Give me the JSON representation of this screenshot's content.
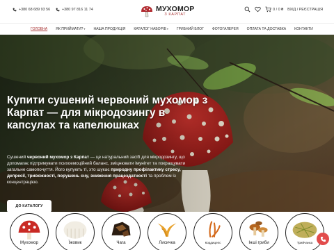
{
  "header": {
    "phones": [
      "+380 68 689 93 56",
      "+380 97 816 11 74"
    ],
    "logo": {
      "title": "МУХОМОР",
      "subtitle": "З КАРПАТ"
    },
    "cart": "0 / 0 ₴",
    "login": "ВХІД / РЕЄСТРАЦІЯ"
  },
  "nav": {
    "items": [
      {
        "label": "ГОЛОВНА",
        "active": true
      },
      {
        "label": "ЯК ПРИЙМАТИ?",
        "has_dropdown": true
      },
      {
        "label": "НАША ПРОДУКЦІЯ",
        "has_dropdown": false
      },
      {
        "label": "КАТАЛОГ НАБОРІВ",
        "has_dropdown": true
      },
      {
        "label": "ГРИБНИЙ БЛОГ",
        "has_dropdown": false
      },
      {
        "label": "ФОТОГАЛЕРЕЯ",
        "has_dropdown": false
      },
      {
        "label": "ОПЛАТА ТА ДОСТАВКА",
        "has_dropdown": false
      },
      {
        "label": "КОНТАКТИ",
        "has_dropdown": false
      }
    ]
  },
  "hero": {
    "title": "Купити сушений червоний мухомор з Карпат — для мікродозингу в капсулах та капелюшках",
    "text_parts": [
      {
        "t": "Сушений ",
        "bold": false
      },
      {
        "t": "червоний мухомор з Карпат",
        "bold": true
      },
      {
        "t": " — це натуральний засіб для мікродозингу, що допомагає підтримувати психоемоційний баланс, зміцнювати імунітет та покращувати загальне самопочуття. Його купують ті, хто шукає ",
        "bold": false
      },
      {
        "t": "природну профілактику стресу, депресії, тривожності, порушень сну, зниження працездатності",
        "bold": true
      },
      {
        "t": " та проблем із концентрацією.",
        "bold": false
      }
    ],
    "button": "ДО КАТАЛОГУ"
  },
  "categories": [
    {
      "label": "Мухомор",
      "icon": "fly-agaric-icon"
    },
    {
      "label": "Їжовик",
      "icon": "lions-mane-icon"
    },
    {
      "label": "Чага",
      "icon": "chaga-icon"
    },
    {
      "label": "Лисичка",
      "icon": "chanterelle-icon"
    },
    {
      "label": "Кордицепс",
      "icon": "cordyceps-icon"
    },
    {
      "label": "Інші гриби",
      "icon": "other-mushrooms-icon"
    },
    {
      "label": "Трийчанка",
      "icon": "herbs-icon"
    }
  ],
  "colors": {
    "accent": "#a83232",
    "fab": "#e24c4c"
  }
}
